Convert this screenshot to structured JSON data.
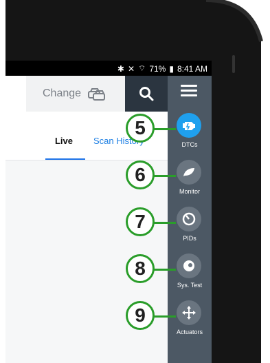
{
  "statusbar": {
    "battery": "71%",
    "time": "8:41 AM"
  },
  "toolbar": {
    "change_label": "Change"
  },
  "tabs": [
    {
      "label": "Live"
    },
    {
      "label": "Scan History"
    }
  ],
  "rail": {
    "items": [
      {
        "label": "DTCs",
        "callout": "5",
        "active": true
      },
      {
        "label": "Monitor",
        "callout": "6",
        "active": false
      },
      {
        "label": "PIDs",
        "callout": "7",
        "active": false
      },
      {
        "label": "Sys. Test",
        "callout": "8",
        "active": false
      },
      {
        "label": "Actuators",
        "callout": "9",
        "active": false
      }
    ]
  },
  "colors": {
    "accent": "#1FA0EE",
    "rail": "#4C5864",
    "callout_green": "#2A9D2A",
    "tab_blue": "#1D7FE3"
  }
}
